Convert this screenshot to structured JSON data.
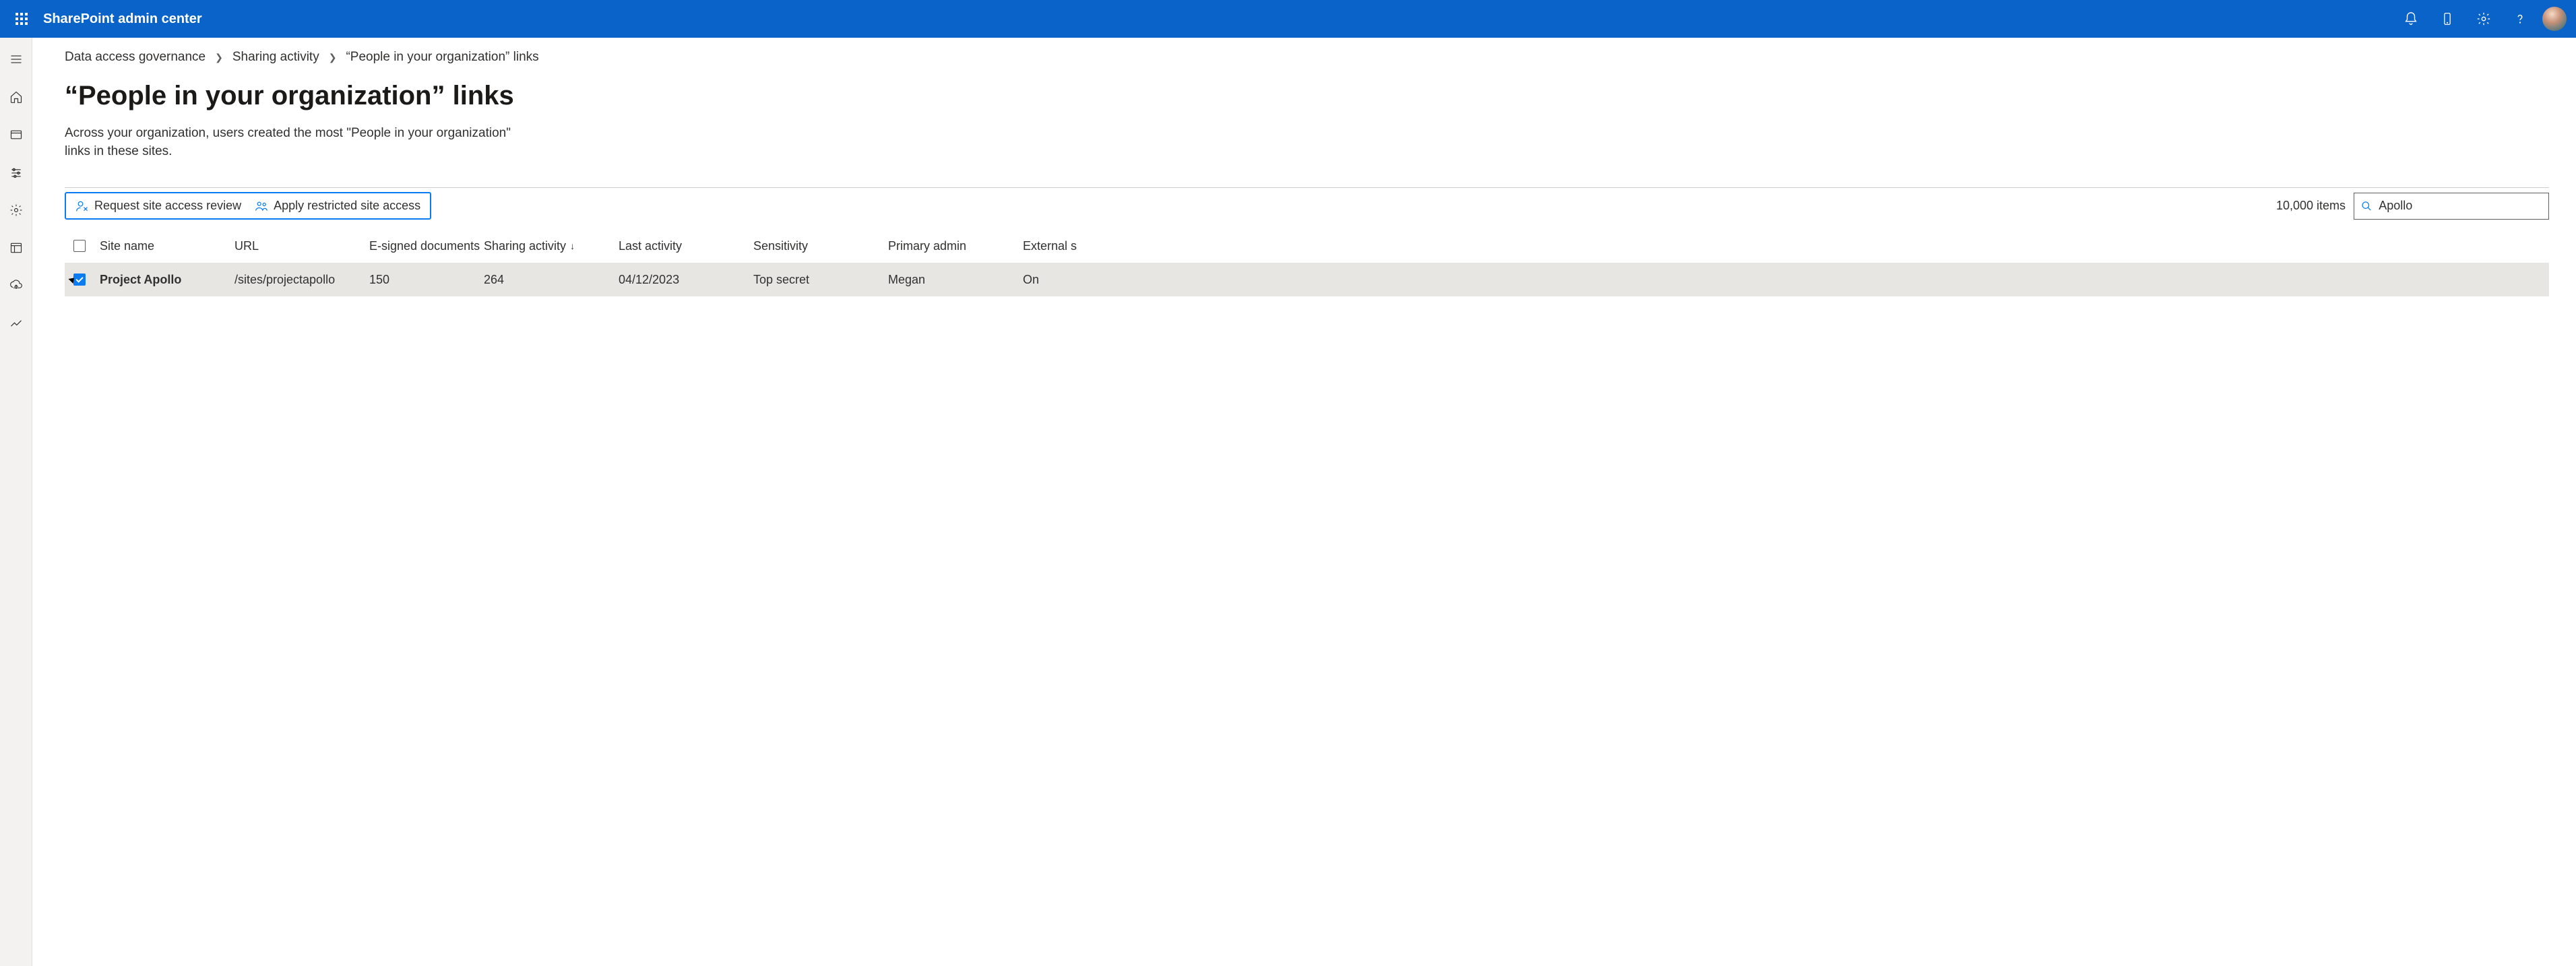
{
  "header": {
    "app_title": "SharePoint admin center"
  },
  "breadcrumb": {
    "item0": "Data access governance",
    "item1": "Sharing activity",
    "item2": "“People in your organization” links"
  },
  "page": {
    "title": "“People in your organization” links",
    "description": "Across your organization, users created the most \"People in your organization\" links in these sites."
  },
  "toolbar": {
    "request_review": "Request site access review",
    "apply_restricted": "Apply restricted site access",
    "item_count": "10,000 items"
  },
  "search": {
    "value": "Apollo"
  },
  "table": {
    "columns": {
      "site_name": "Site name",
      "url": "URL",
      "esigned": "E-signed documents",
      "sharing_activity": "Sharing activity",
      "last_activity": "Last activity",
      "sensitivity": "Sensitivity",
      "primary_admin": "Primary admin",
      "external": "External s"
    },
    "rows": [
      {
        "selected": true,
        "site_name": "Project Apollo",
        "url": "/sites/projectapollo",
        "esigned": "150",
        "sharing_activity": "264",
        "last_activity": "04/12/2023",
        "sensitivity": "Top secret",
        "primary_admin": "Megan",
        "external": "On"
      }
    ]
  }
}
